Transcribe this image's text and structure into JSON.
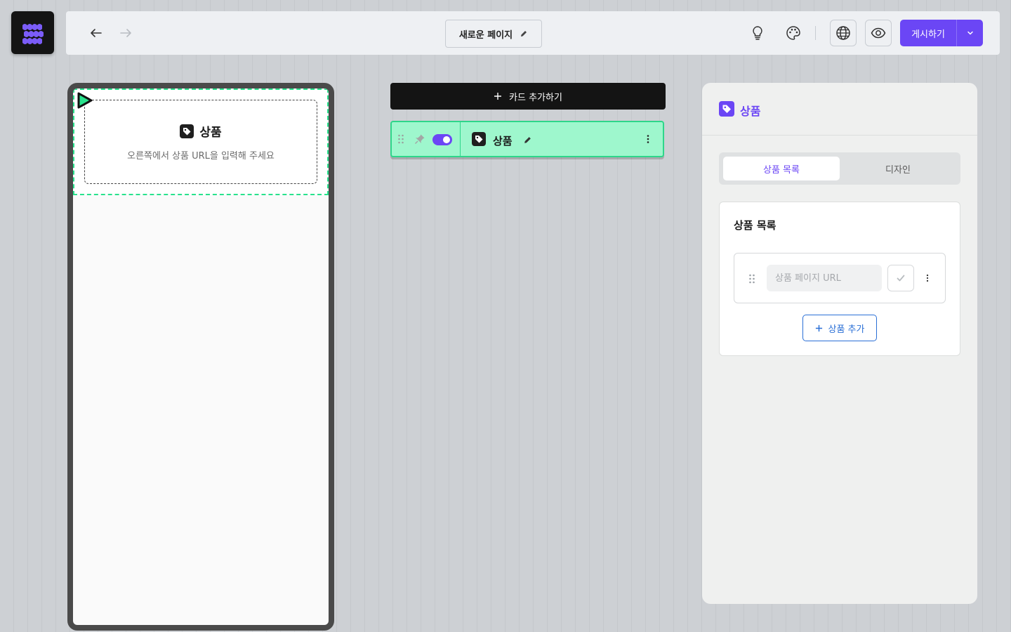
{
  "topbar": {
    "page_name": "새로운 페이지",
    "publish_label": "게시하기"
  },
  "preview": {
    "block_title": "상품",
    "block_hint": "오른쪽에서 상품 URL을 입력해 주세요"
  },
  "editor": {
    "add_card_label": "카드 추가하기",
    "card_title": "상품",
    "card_enabled": true
  },
  "panel": {
    "title": "상품",
    "tabs": [
      {
        "label": "상품 목록",
        "active": true
      },
      {
        "label": "디자인",
        "active": false
      }
    ],
    "section_title": "상품 목록",
    "url_placeholder": "상품 페이지 URL",
    "add_product_label": "상품 추가"
  },
  "colors": {
    "accent": "#6b46f5",
    "selection": "#29e28d",
    "link": "#2a6fd6"
  }
}
